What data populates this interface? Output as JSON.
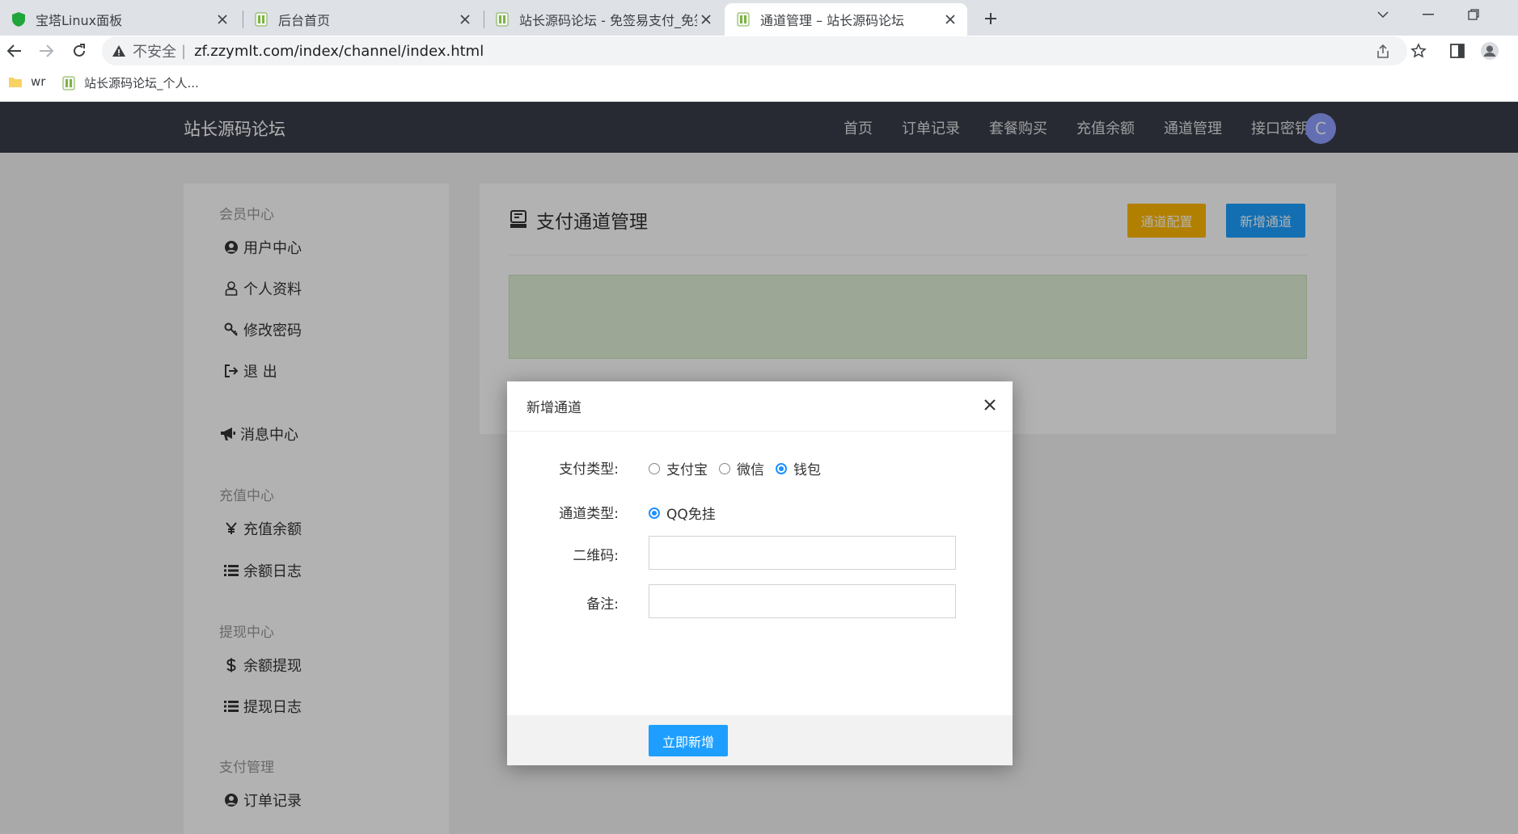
{
  "browser": {
    "tabs": [
      {
        "title": "宝塔Linux面板",
        "icon": "bt-shield-icon"
      },
      {
        "title": "后台首页",
        "icon": "site-favicon-icon"
      },
      {
        "title": "站长源码论坛 - 免签易支付_免签",
        "icon": "site-favicon-icon"
      },
      {
        "title": "通道管理 – 站长源码论坛",
        "icon": "site-favicon-icon",
        "active": true
      }
    ],
    "address": {
      "security_label": "不安全",
      "url": "zf.zzymlt.com/index/channel/index.html"
    },
    "bookmarks": [
      {
        "label": "wr",
        "icon": "folder-icon"
      },
      {
        "label": "站长源码论坛_个人...",
        "icon": "site-favicon-icon"
      }
    ]
  },
  "header": {
    "brand": "站长源码论坛",
    "nav": [
      "首页",
      "订单记录",
      "套餐购买",
      "充值余额",
      "通道管理",
      "接口密钥"
    ],
    "avatar_letter": "C"
  },
  "sidebar": {
    "groups": [
      {
        "title": "会员中心",
        "items": [
          {
            "label": "用户中心",
            "icon": "user-circle-icon"
          },
          {
            "label": "个人资料",
            "icon": "user-outline-icon"
          },
          {
            "label": "修改密码",
            "icon": "key-icon"
          },
          {
            "label": "退 出",
            "icon": "sign-out-icon"
          }
        ]
      },
      {
        "title": "",
        "items": [
          {
            "label": "消息中心",
            "icon": "bullhorn-icon"
          }
        ]
      },
      {
        "title": "充值中心",
        "items": [
          {
            "label": "充值余额",
            "icon": "yen-icon"
          },
          {
            "label": "余额日志",
            "icon": "list-icon"
          }
        ]
      },
      {
        "title": "提现中心",
        "items": [
          {
            "label": "余额提现",
            "icon": "dollar-icon"
          },
          {
            "label": "提现日志",
            "icon": "list-icon"
          }
        ]
      },
      {
        "title": "支付管理",
        "items": [
          {
            "label": "订单记录",
            "icon": "user-circle-icon"
          }
        ]
      }
    ]
  },
  "main": {
    "title": "支付通道管理",
    "title_icon": "pay-channel-icon",
    "config_button": "通道配置",
    "add_button": "新增通道"
  },
  "modal": {
    "title": "新增通道",
    "pay_type": {
      "label": "支付类型:",
      "options": [
        "支付宝",
        "微信",
        "钱包"
      ],
      "selected": "钱包"
    },
    "channel_type": {
      "label": "通道类型:",
      "options": [
        "QQ免挂"
      ],
      "selected": "QQ免挂"
    },
    "qrcode": {
      "label": "二维码:",
      "value": ""
    },
    "remark": {
      "label": "备注:",
      "value": ""
    },
    "submit_label": "立即新增"
  },
  "colors": {
    "topnav_bg": "#393d49",
    "primary": "#1e9fff",
    "warm": "#ffb800",
    "tip_bg": "#e1f0d6"
  }
}
